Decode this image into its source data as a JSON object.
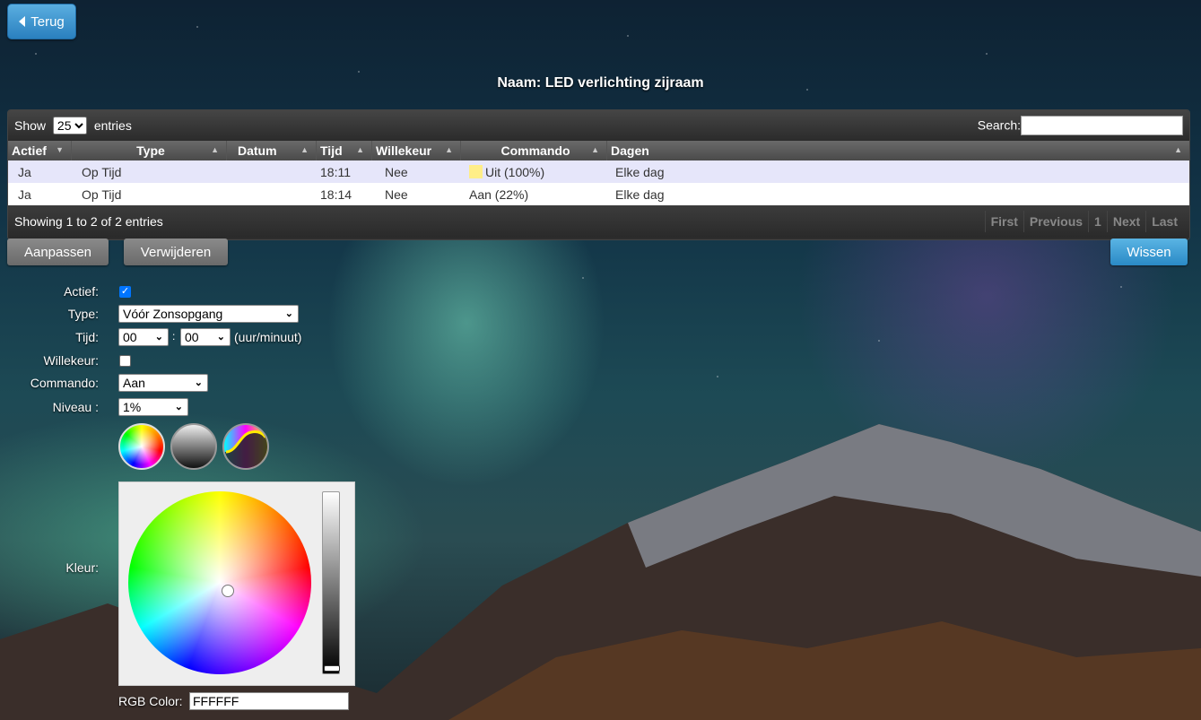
{
  "nav": {
    "back_label": "Terug"
  },
  "page": {
    "title": "Naam: LED verlichting zijraam"
  },
  "table": {
    "show_label": "Show",
    "page_size": "25",
    "entries_label": "entries",
    "search_label": "Search:",
    "search_value": "",
    "columns": [
      "Actief",
      "Type",
      "Datum",
      "Tijd",
      "Willekeur",
      "Commando",
      "Dagen"
    ],
    "rows": [
      {
        "actief": "Ja",
        "type": "Op Tijd",
        "datum": "",
        "tijd": "18:11",
        "willekeur": "Nee",
        "commando": "Uit (100%)",
        "dagen": "Elke dag",
        "swatch_color": "#ffee88"
      },
      {
        "actief": "Ja",
        "type": "Op Tijd",
        "datum": "",
        "tijd": "18:14",
        "willekeur": "Nee",
        "commando": "Aan (22%)",
        "dagen": "Elke dag"
      }
    ],
    "info": "Showing 1 to 2 of 2 entries",
    "pager": {
      "first": "First",
      "previous": "Previous",
      "page": "1",
      "next": "Next",
      "last": "Last"
    }
  },
  "actions": {
    "edit": "Aanpassen",
    "delete": "Verwijderen",
    "clear": "Wissen"
  },
  "form": {
    "actief_label": "Actief:",
    "actief_checked": true,
    "type_label": "Type:",
    "type_value": "Vóór Zonsopgang",
    "tijd_label": "Tijd:",
    "hour_value": "00",
    "minute_value": "00",
    "time_separator": ":",
    "time_hint": "(uur/minuut)",
    "willekeur_label": "Willekeur:",
    "willekeur_checked": false,
    "commando_label": "Commando:",
    "commando_value": "Aan",
    "niveau_label": "Niveau :",
    "niveau_value": "1%",
    "kleur_label": "Kleur:",
    "rgb_label": "RGB Color:",
    "rgb_value": "FFFFFF",
    "color_modes": [
      "color-wheel-icon",
      "white-gradient-icon",
      "color-temp-curve-icon"
    ]
  },
  "colors": {
    "accent_blue": "#2a8ac6",
    "row_alt": "#e6e6fa"
  }
}
